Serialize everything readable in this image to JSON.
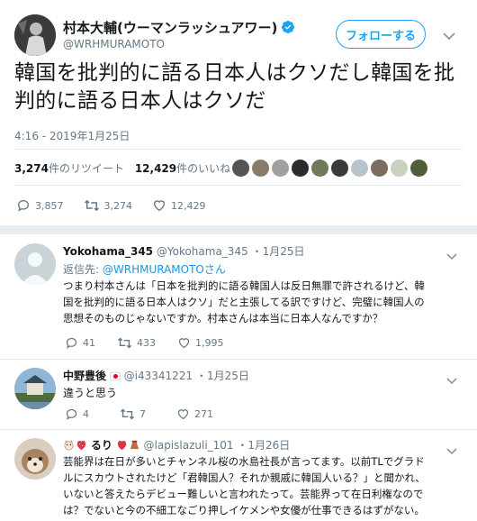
{
  "main_tweet": {
    "display_name": "村本大輔(ウーマンラッシュアワー)",
    "handle": "@WRHMURAMOTO",
    "follow_label": "フォローする",
    "text": "韓国を批判的に語る日本人はクソだし韓国を批判的に語る日本人はクソだ",
    "timestamp": "4:16 - 2019年1月25日",
    "retweets_count": "3,274",
    "retweets_label": "件のリツイート",
    "likes_count": "12,429",
    "likes_label": "件のいいね",
    "reply_count": "3,857",
    "retweet_count": "3,274",
    "like_count": "12,429"
  },
  "replies": [
    {
      "name": "Yokohama_345",
      "handle": "@Yokohama_345",
      "date": "1月25日",
      "reply_to_prefix": "返信先:",
      "reply_to_handle": "@WRHMURAMOTO",
      "reply_to_suffix": "さん",
      "lines": [
        "つまり村本さんは「日本を批判的に語る韓国人は反日無罪で許されるけど、韓",
        "国を批判的に語る日本人はクソ」だと主張してる訳ですけど、完璧に韓国人の",
        "思想そのものじゃないですか。村本さんは本当に日本人なんですか？"
      ],
      "reply_count": "41",
      "retweet_count": "433",
      "like_count": "1,995"
    },
    {
      "name": "中野豊後",
      "handle": "@i43341221",
      "date": "1月25日",
      "lines": [
        "違うと思う"
      ],
      "reply_count": "4",
      "retweet_count": "7",
      "like_count": "271"
    },
    {
      "name": "るり",
      "handle": "@lapislazuli_101",
      "date": "1月26日",
      "lines": [
        "芸能界は在日が多いとチャンネル桜の水島社長が言ってます。以前TLでグラド",
        "ルにスカウトされたけど「君韓国人？それか親戚に韓国人いる？」と聞かれ、",
        "いないと答えたらデビュー難しいと言われたって。芸能界って在日利権なので",
        "は？でないと今の不細工なごり押しイケメンや女優が仕事できるはずがない。"
      ]
    }
  ],
  "separator": "・",
  "colors": {
    "accent": "#1da1f2",
    "link": "#1b95e0",
    "muted": "#657786",
    "border": "#e6ecf0",
    "verified": "#1da1f2"
  }
}
